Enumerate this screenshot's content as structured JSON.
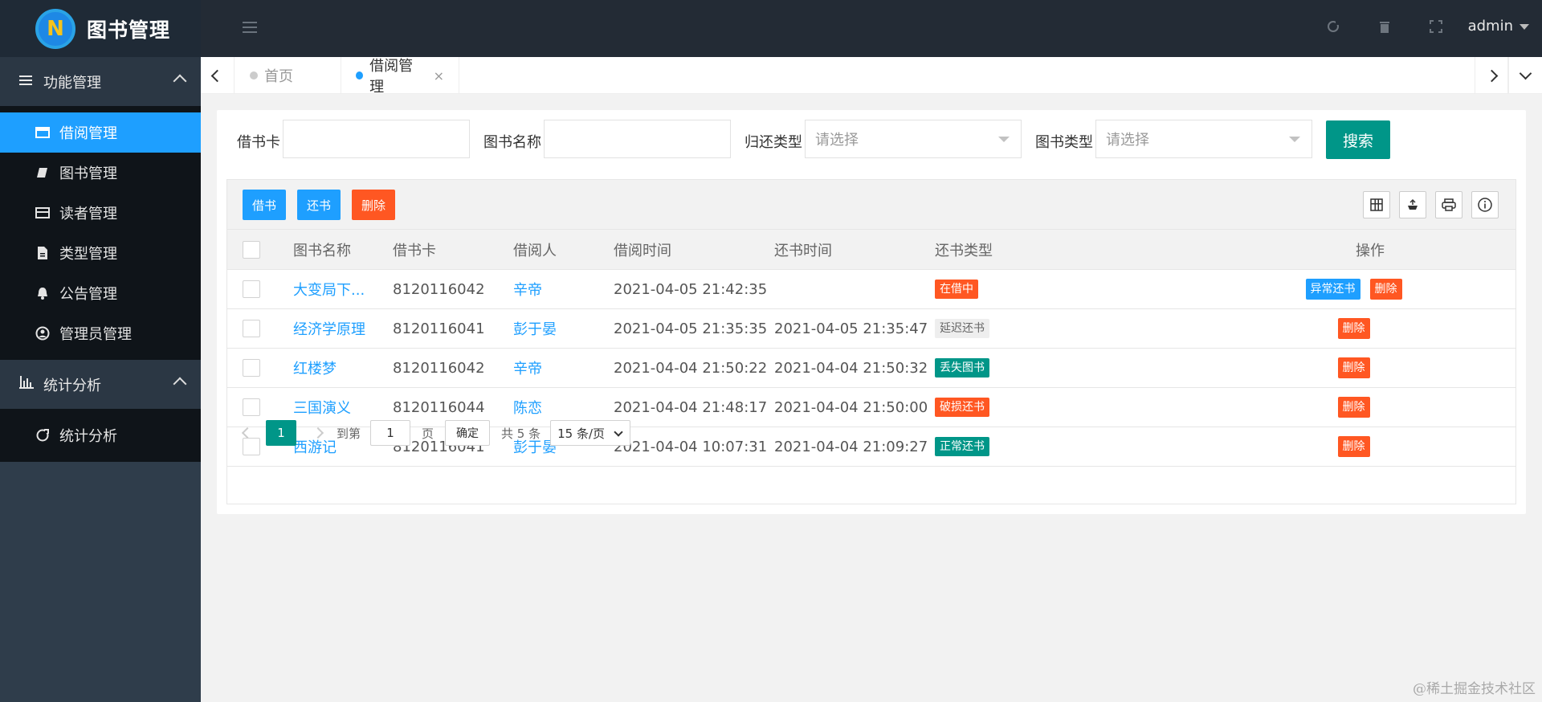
{
  "app": {
    "title": "图书管理",
    "logo_letter": "N"
  },
  "sidebar": {
    "groups": [
      {
        "label": "功能管理",
        "icon": "list-icon",
        "items": [
          {
            "label": "借阅管理",
            "icon": "window-icon",
            "active": true
          },
          {
            "label": "图书管理",
            "icon": "book-icon"
          },
          {
            "label": "读者管理",
            "icon": "card-icon"
          },
          {
            "label": "类型管理",
            "icon": "file-icon"
          },
          {
            "label": "公告管理",
            "icon": "bell-icon"
          },
          {
            "label": "管理员管理",
            "icon": "user-circle-icon"
          }
        ]
      },
      {
        "label": "统计分析",
        "icon": "bar-chart-icon",
        "items": [
          {
            "label": "统计分析",
            "icon": "refresh-icon"
          }
        ]
      }
    ]
  },
  "topbar": {
    "user": "admin"
  },
  "tabs": [
    {
      "label": "首页",
      "active": false
    },
    {
      "label": "借阅管理",
      "active": true
    }
  ],
  "search": {
    "card_label": "借书卡",
    "book_name_label": "图书名称",
    "return_type_label": "归还类型",
    "return_type_placeholder": "请选择",
    "book_type_label": "图书类型",
    "book_type_placeholder": "请选择",
    "search_button": "搜索"
  },
  "toolbar": {
    "borrow": "借书",
    "return": "还书",
    "delete": "删除"
  },
  "table": {
    "columns": [
      "图书名称",
      "借书卡",
      "借阅人",
      "借阅时间",
      "还书时间",
      "还书类型",
      "操作"
    ],
    "rows": [
      {
        "book": "大变局下...",
        "card": "8120116042",
        "reader": "辛帝",
        "borrow_time": "2021-04-05 21:42:35",
        "return_time": "",
        "type": "在借中",
        "type_color": "#ff5722",
        "actions": [
          "异常还书",
          "删除"
        ]
      },
      {
        "book": "经济学原理",
        "card": "8120116041",
        "reader": "彭于晏",
        "borrow_time": "2021-04-05 21:35:35",
        "return_time": "2021-04-05 21:35:47",
        "type": "延迟还书",
        "type_color": "#eeeeee",
        "actions": [
          "删除"
        ]
      },
      {
        "book": "红楼梦",
        "card": "8120116042",
        "reader": "辛帝",
        "borrow_time": "2021-04-04 21:50:22",
        "return_time": "2021-04-04 21:50:32",
        "type": "丢失图书",
        "type_color": "#009688",
        "actions": [
          "删除"
        ]
      },
      {
        "book": "三国演义",
        "card": "8120116044",
        "reader": "陈恋",
        "borrow_time": "2021-04-04 21:48:17",
        "return_time": "2021-04-04 21:50:00",
        "type": "破损还书",
        "type_color": "#ff5722",
        "actions": [
          "删除"
        ]
      },
      {
        "book": "西游记",
        "card": "8120116041",
        "reader": "彭于晏",
        "borrow_time": "2021-04-04 10:07:31",
        "return_time": "2021-04-04 21:09:27",
        "type": "正常还书",
        "type_color": "#009688",
        "actions": [
          "删除"
        ]
      }
    ]
  },
  "pager": {
    "current": "1",
    "goto_label": "到第",
    "goto_value": "1",
    "page_unit": "页",
    "confirm": "确定",
    "total": "共 5 条",
    "page_size": "15 条/页"
  },
  "colors": {
    "primary": "#009688",
    "blue": "#1e9fff",
    "danger": "#ff5722"
  },
  "watermark": "@稀土掘金技术社区"
}
